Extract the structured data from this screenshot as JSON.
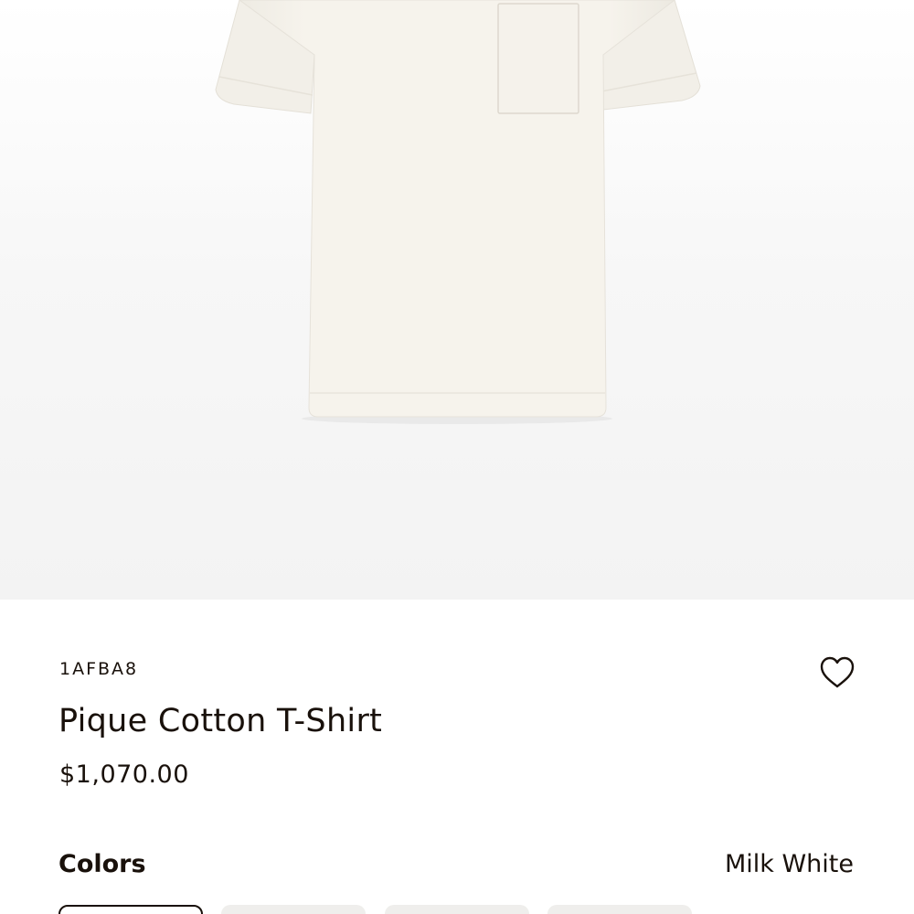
{
  "product": {
    "sku": "1AFBA8",
    "name": "Pique Cotton T-Shirt",
    "price": "$1,070.00",
    "image_alt": "Pique Cotton T-Shirt in Milk White"
  },
  "colors": {
    "label": "Colors",
    "selected": "Milk White",
    "swatch_count": 4
  },
  "icons": {
    "wishlist": "heart-outline-icon"
  },
  "palette": {
    "text": "#19110b",
    "shirt": "#f4f1ea",
    "background": "#f3f3f3"
  }
}
